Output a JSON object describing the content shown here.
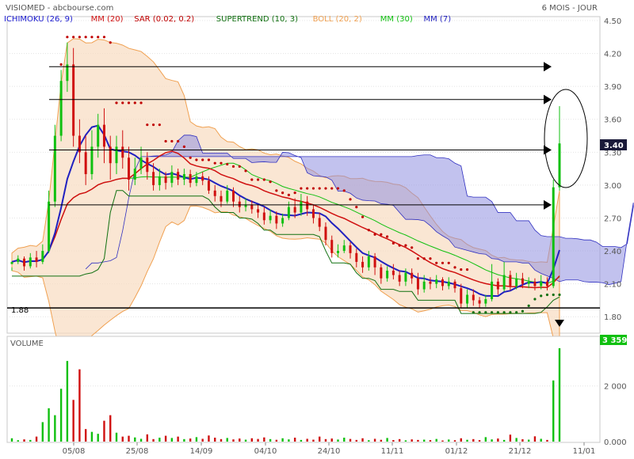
{
  "header": {
    "title": "VISIOMED - abcbourse.com",
    "period": "6 MOIS - JOUR"
  },
  "legend": [
    {
      "label": "ICHIMOKU (26, 9)",
      "color": "#1a1ad0"
    },
    {
      "label": "MM (20)",
      "color": "#d01010"
    },
    {
      "label": "SAR (0.02, 0.2)",
      "color": "#c00000"
    },
    {
      "label": "SUPERTREND (10, 3)",
      "color": "#107010"
    },
    {
      "label": "BOLL (20, 2)",
      "color": "#f0a050"
    },
    {
      "label": "MM (30)",
      "color": "#10c010"
    },
    {
      "label": "MM (7)",
      "color": "#2020c0"
    }
  ],
  "chart_data": {
    "type": "candlestick",
    "y_ticks": [
      "4.50",
      "4.20",
      "3.90",
      "3.60",
      "3.30",
      "3.00",
      "2.70",
      "2.40",
      "2.10",
      "1.80"
    ],
    "ylim": [
      1.65,
      4.5
    ],
    "x_ticks": [
      "05/08",
      "25/08",
      "14/09",
      "04/10",
      "24/10",
      "11/11",
      "01/12",
      "21/12",
      "11/01"
    ],
    "last_price": "3.40",
    "support_level": "1.88",
    "resistance_levels": [
      4.08,
      3.78,
      3.32,
      2.82
    ],
    "colors": {
      "up": "#10c010",
      "down": "#d01010",
      "cloud": "#9090e0",
      "boll": "#f8dcc0"
    },
    "candles": [
      [
        2.28,
        2.3,
        2.25,
        2.22
      ],
      [
        2.3,
        2.33,
        2.36,
        2.28
      ],
      [
        2.33,
        2.26,
        2.35,
        2.22
      ],
      [
        2.26,
        2.34,
        2.38,
        2.24
      ],
      [
        2.34,
        2.3,
        2.4,
        2.25
      ],
      [
        2.3,
        2.4,
        2.46,
        2.28
      ],
      [
        2.4,
        2.85,
        2.95,
        2.38
      ],
      [
        2.85,
        3.45,
        3.55,
        2.8
      ],
      [
        3.45,
        3.95,
        4.05,
        3.4
      ],
      [
        3.95,
        4.1,
        4.3,
        3.85
      ],
      [
        4.1,
        3.45,
        4.25,
        3.35
      ],
      [
        3.45,
        3.3,
        3.6,
        3.2
      ],
      [
        3.3,
        3.1,
        3.45,
        3.0
      ],
      [
        3.1,
        3.35,
        3.5,
        3.05
      ],
      [
        3.35,
        3.55,
        3.65,
        3.25
      ],
      [
        3.55,
        3.35,
        3.7,
        3.2
      ],
      [
        3.35,
        3.2,
        3.45,
        3.05
      ],
      [
        3.2,
        3.35,
        3.45,
        3.1
      ],
      [
        3.35,
        3.25,
        3.5,
        3.15
      ],
      [
        3.25,
        3.05,
        3.35,
        2.95
      ],
      [
        3.05,
        3.15,
        3.25,
        3.0
      ],
      [
        3.15,
        3.25,
        3.35,
        3.1
      ],
      [
        3.25,
        3.12,
        3.3,
        3.05
      ],
      [
        3.12,
        3.0,
        3.2,
        2.95
      ],
      [
        3.0,
        3.08,
        3.15,
        2.95
      ],
      [
        3.08,
        3.02,
        3.12,
        2.96
      ],
      [
        3.02,
        3.12,
        3.18,
        2.98
      ],
      [
        3.12,
        3.05,
        3.15,
        3.0
      ],
      [
        3.05,
        3.1,
        3.15,
        3.0
      ],
      [
        3.1,
        3.02,
        3.14,
        2.98
      ],
      [
        3.02,
        3.08,
        3.12,
        2.99
      ],
      [
        3.08,
        3.04,
        3.12,
        3.0
      ],
      [
        3.04,
        2.95,
        3.08,
        2.92
      ],
      [
        2.95,
        2.9,
        3.0,
        2.85
      ],
      [
        2.9,
        2.85,
        2.95,
        2.8
      ],
      [
        2.85,
        2.95,
        3.0,
        2.83
      ],
      [
        2.95,
        2.85,
        2.98,
        2.8
      ],
      [
        2.85,
        2.8,
        2.9,
        2.75
      ],
      [
        2.8,
        2.82,
        2.88,
        2.76
      ],
      [
        2.82,
        2.78,
        2.86,
        2.74
      ],
      [
        2.78,
        2.75,
        2.82,
        2.7
      ],
      [
        2.75,
        2.68,
        2.8,
        2.64
      ],
      [
        2.68,
        2.72,
        2.78,
        2.65
      ],
      [
        2.72,
        2.65,
        2.76,
        2.6
      ],
      [
        2.65,
        2.7,
        2.74,
        2.62
      ],
      [
        2.7,
        2.8,
        2.85,
        2.68
      ],
      [
        2.8,
        2.75,
        2.88,
        2.7
      ],
      [
        2.75,
        2.85,
        2.92,
        2.72
      ],
      [
        2.85,
        2.78,
        2.9,
        2.72
      ],
      [
        2.78,
        2.7,
        2.82,
        2.65
      ],
      [
        2.7,
        2.62,
        2.75,
        2.58
      ],
      [
        2.62,
        2.5,
        2.66,
        2.45
      ],
      [
        2.5,
        2.38,
        2.54,
        2.34
      ],
      [
        2.38,
        2.4,
        2.46,
        2.34
      ],
      [
        2.4,
        2.45,
        2.5,
        2.38
      ],
      [
        2.45,
        2.38,
        2.48,
        2.33
      ],
      [
        2.38,
        2.3,
        2.42,
        2.25
      ],
      [
        2.3,
        2.25,
        2.35,
        2.2
      ],
      [
        2.25,
        2.35,
        2.4,
        2.22
      ],
      [
        2.35,
        2.25,
        2.38,
        2.18
      ],
      [
        2.25,
        2.15,
        2.28,
        2.1
      ],
      [
        2.15,
        2.22,
        2.26,
        2.12
      ],
      [
        2.22,
        2.18,
        2.28,
        2.14
      ],
      [
        2.18,
        2.12,
        2.22,
        2.08
      ],
      [
        2.12,
        2.2,
        2.24,
        2.08
      ],
      [
        2.2,
        2.15,
        2.24,
        2.1
      ],
      [
        2.15,
        2.05,
        2.2,
        2.0
      ],
      [
        2.05,
        2.12,
        2.18,
        2.02
      ],
      [
        2.12,
        2.1,
        2.16,
        2.05
      ],
      [
        2.1,
        2.14,
        2.18,
        2.06
      ],
      [
        2.14,
        2.08,
        2.16,
        2.04
      ],
      [
        2.08,
        2.12,
        2.16,
        2.05
      ],
      [
        2.12,
        2.06,
        2.14,
        2.02
      ],
      [
        2.06,
        1.92,
        2.1,
        1.88
      ],
      [
        1.92,
        2.0,
        2.05,
        1.88
      ],
      [
        2.0,
        1.95,
        2.05,
        1.9
      ],
      [
        1.95,
        1.92,
        1.98,
        1.88
      ],
      [
        1.92,
        1.96,
        2.0,
        1.89
      ],
      [
        1.96,
        2.12,
        2.28,
        1.94
      ],
      [
        2.12,
        2.05,
        2.15,
        2.0
      ],
      [
        2.05,
        2.18,
        2.3,
        2.03
      ],
      [
        2.18,
        2.08,
        2.22,
        2.04
      ],
      [
        2.08,
        2.15,
        2.2,
        2.05
      ],
      [
        2.15,
        2.1,
        2.2,
        2.06
      ],
      [
        2.1,
        2.12,
        2.16,
        2.06
      ],
      [
        2.12,
        2.08,
        2.15,
        2.04
      ],
      [
        2.08,
        2.12,
        2.18,
        2.05
      ],
      [
        2.12,
        2.08,
        2.16,
        2.04
      ],
      [
        2.08,
        2.98,
        3.05,
        2.06
      ],
      [
        2.98,
        3.38,
        3.72,
        2.95
      ]
    ],
    "volume": {
      "ticks": [
        "2 000",
        "0.000"
      ],
      "max_label": "3 359",
      "max": 3359,
      "values": [
        120,
        50,
        80,
        60,
        180,
        700,
        1200,
        950,
        1900,
        2900,
        1500,
        2600,
        450,
        350,
        280,
        750,
        950,
        320,
        180,
        210,
        150,
        100,
        260,
        90,
        140,
        210,
        130,
        180,
        90,
        110,
        160,
        100,
        220,
        140,
        90,
        130,
        80,
        110,
        70,
        120,
        95,
        150,
        90,
        65,
        120,
        80,
        140,
        60,
        100,
        70,
        180,
        90,
        110,
        75,
        140,
        95,
        60,
        120,
        50,
        100,
        65,
        130,
        55,
        90,
        45,
        80,
        60,
        70,
        55,
        95,
        40,
        75,
        50,
        120,
        65,
        90,
        55,
        160,
        80,
        110,
        60,
        250,
        130,
        85,
        70,
        190,
        100,
        60,
        2200,
        3359
      ]
    }
  }
}
